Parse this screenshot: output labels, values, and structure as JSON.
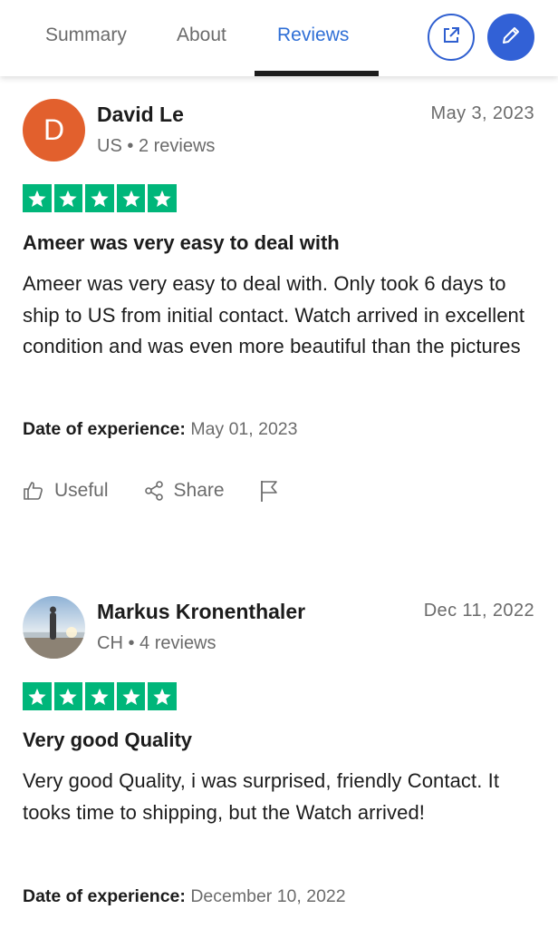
{
  "tabs": {
    "summary": "Summary",
    "about": "About",
    "reviews": "Reviews",
    "active": "Reviews"
  },
  "header_buttons": {
    "external": {
      "icon": "external-link-icon"
    },
    "edit": {
      "icon": "pencil-icon"
    }
  },
  "colors": {
    "accent": "#2f6fd6",
    "star_green": "#00b67a",
    "avatar_orange": "#e2602d"
  },
  "reviews": [
    {
      "avatar_letter": "D",
      "name": "David Le",
      "country": "US",
      "separator": "•",
      "review_count": "2 reviews",
      "date": "May 3, 2023",
      "rating": 5,
      "title": "Ameer was very easy to deal with",
      "body": "Ameer was very easy to deal with. Only took 6 days to ship to US from initial contact. Watch arrived in excellent condition and was even more beautiful than the pictures",
      "experience_label": "Date of experience:",
      "experience_date": "May 01, 2023",
      "actions": {
        "useful": "Useful",
        "share": "Share"
      }
    },
    {
      "avatar_letter": "",
      "name": "Markus Kronenthaler",
      "country": "CH",
      "separator": "•",
      "review_count": "4 reviews",
      "date": "Dec 11, 2022",
      "rating": 5,
      "title": "Very good Quality",
      "body": "Very good Quality, i was surprised, friendly Contact. It tooks time to shipping, but the Watch arrived!",
      "experience_label": "Date of experience:",
      "experience_date": "December 10, 2022"
    }
  ]
}
